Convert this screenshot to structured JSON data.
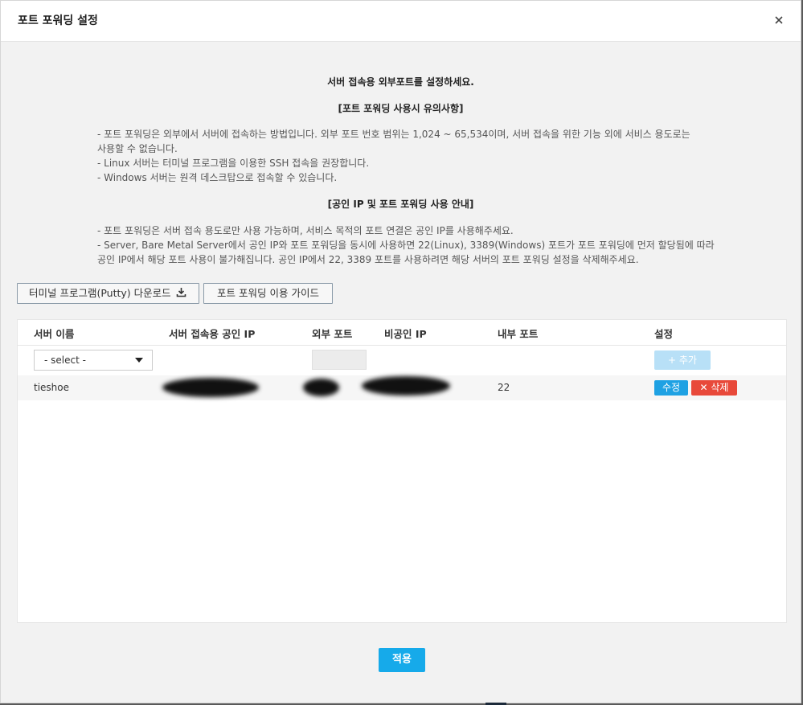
{
  "dialog": {
    "title": "포트 포워딩 설정",
    "close_icon": "close-icon"
  },
  "notice": {
    "heading_main": "서버 접속용 외부포트를 설정하세요.",
    "heading_caution": "[포트 포워딩 사용시 유의사항]",
    "caution_lines": [
      "- 포트 포워딩은 외부에서 서버에 접속하는 방법입니다. 외부 포트 번호 범위는 1,024 ~ 65,534이며, 서버 접속을 위한 기능 외에 서비스 용도로는",
      "사용할 수 없습니다.",
      "- Linux 서버는 터미널 프로그램을 이용한 SSH 접속을 권장합니다.",
      "- Windows 서버는 원격 데스크탑으로 접속할 수 있습니다."
    ],
    "heading_publicip": "[공인 IP 및 포트 포워딩 사용 안내]",
    "publicip_lines": [
      "- 포트 포워딩은 서버 접속 용도로만 사용 가능하며, 서비스 목적의 포트 연결은 공인 IP를 사용해주세요.",
      "- Server, Bare Metal Server에서 공인 IP와 포트 포워딩을 동시에 사용하면 22(Linux), 3389(Windows) 포트가 포트 포워딩에 먼저 할당됨에 따라",
      "공인 IP에서 해당 포트 사용이 불가해집니다. 공인 IP에서 22, 3389 포트를 사용하려면 해당 서버의 포트 포워딩 설정을 삭제해주세요."
    ]
  },
  "buttons": {
    "putty_download": "터미널 프로그램(Putty) 다운로드",
    "guide": "포트 포워딩 이용 가이드",
    "add": "+ 추가",
    "edit": "수정",
    "delete": "✕ 삭제",
    "apply": "적용"
  },
  "table": {
    "headers": [
      "서버 이름",
      "서버 접속용 공인 IP",
      "외부 포트",
      "비공인 IP",
      "내부 포트",
      "설정"
    ],
    "select_value": "- select -",
    "rows": [
      {
        "server_name": "tieshoe",
        "internal_port": "22"
      }
    ]
  },
  "colors": {
    "primary": "#16aaea",
    "edit": "#1ea1e3",
    "delete": "#e8493a",
    "add_disabled": "#b8e0f7"
  }
}
